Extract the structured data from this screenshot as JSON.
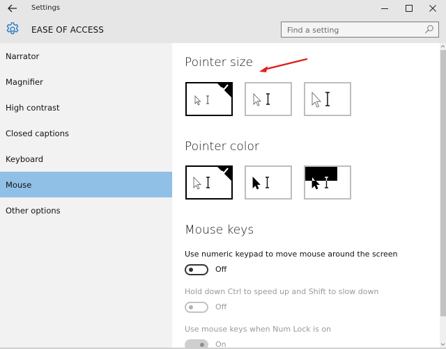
{
  "window": {
    "title": "Settings",
    "back_icon": "back-arrow-icon",
    "controls": {
      "minimize_icon": "minimize-icon",
      "maximize_icon": "maximize-icon",
      "close_icon": "close-icon"
    }
  },
  "header": {
    "icon": "gear-icon",
    "section_title": "EASE OF ACCESS",
    "search": {
      "placeholder": "Find a setting",
      "value": "",
      "icon": "search-icon"
    }
  },
  "sidebar": {
    "items": [
      {
        "label": "Narrator",
        "active": false
      },
      {
        "label": "Magnifier",
        "active": false
      },
      {
        "label": "High contrast",
        "active": false
      },
      {
        "label": "Closed captions",
        "active": false
      },
      {
        "label": "Keyboard",
        "active": false
      },
      {
        "label": "Mouse",
        "active": true
      },
      {
        "label": "Other options",
        "active": false
      }
    ],
    "active_color": "#91c0e7"
  },
  "main": {
    "pointer_size": {
      "heading": "Pointer size",
      "options": [
        {
          "name": "small",
          "selected": true
        },
        {
          "name": "medium",
          "selected": false
        },
        {
          "name": "large",
          "selected": false
        }
      ]
    },
    "pointer_color": {
      "heading": "Pointer color",
      "options": [
        {
          "name": "white",
          "selected": true
        },
        {
          "name": "black",
          "selected": false
        },
        {
          "name": "inverted",
          "selected": false
        }
      ]
    },
    "mouse_keys": {
      "heading": "Mouse keys",
      "settings": [
        {
          "label": "Use numeric keypad to move mouse around the screen",
          "state": "Off",
          "enabled": true
        },
        {
          "label": "Hold down Ctrl to speed up and Shift to slow down",
          "state": "Off",
          "enabled": false
        },
        {
          "label": "Use mouse keys when Num Lock is on",
          "state": "On",
          "enabled": false
        }
      ]
    }
  },
  "annotation": {
    "type": "red-arrow",
    "color": "#e0201b",
    "points_to": "Pointer size"
  }
}
